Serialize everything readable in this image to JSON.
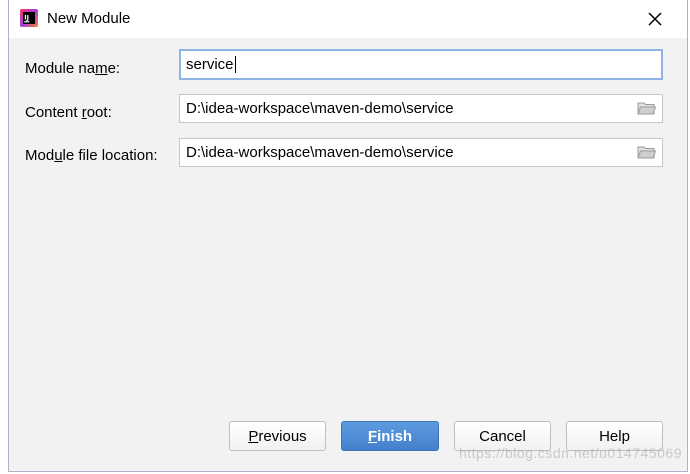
{
  "window": {
    "title": "New Module"
  },
  "form": {
    "module_name": {
      "label_pre": "Module na",
      "label_mnemonic": "m",
      "label_post": "e:",
      "value": "service"
    },
    "content_root": {
      "label_pre": "Content ",
      "label_mnemonic": "r",
      "label_post": "oot:",
      "value": "D:\\idea-workspace\\maven-demo\\service"
    },
    "module_file_location": {
      "label_pre": "Mod",
      "label_mnemonic": "u",
      "label_post": "le file location:",
      "value": "D:\\idea-workspace\\maven-demo\\service"
    }
  },
  "buttons": {
    "previous": {
      "mnemonic": "P",
      "rest": "revious"
    },
    "finish": {
      "mnemonic": "F",
      "rest": "inish"
    },
    "cancel": "Cancel",
    "help": "Help"
  },
  "watermark": "https://blog.csdn.net/u014745069",
  "colors": {
    "accent": "#4a89d6",
    "focus_border": "#8cb5e3",
    "dialog_bg": "#f2f2f2"
  },
  "icons": {
    "app": "intellij-idea-icon",
    "close": "close-icon",
    "folder": "folder-icon"
  }
}
